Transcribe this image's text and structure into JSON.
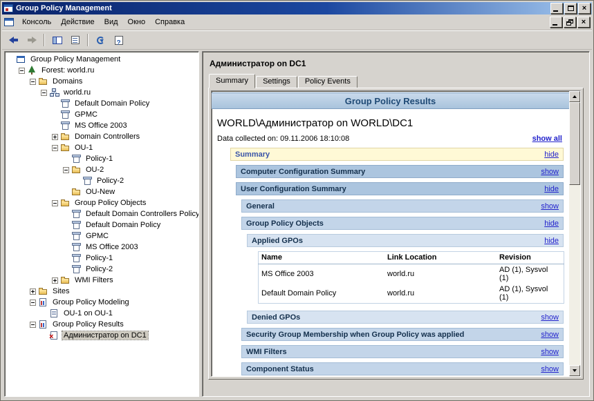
{
  "window": {
    "title": "Group Policy Management",
    "buttons": [
      "minimize",
      "maximize",
      "close"
    ]
  },
  "menubar": {
    "items": [
      "Консоль",
      "Действие",
      "Вид",
      "Окно",
      "Справка"
    ],
    "child_buttons": [
      "minimize",
      "restore",
      "close"
    ]
  },
  "toolbar": {
    "buttons": [
      "back",
      "forward",
      "separator",
      "show-console-tree",
      "export-list",
      "separator",
      "refresh",
      "help"
    ]
  },
  "tree": {
    "items": [
      {
        "depth": 0,
        "expander": null,
        "icon": "console-root",
        "label": "Group Policy Management"
      },
      {
        "depth": 1,
        "expander": "-",
        "icon": "forest",
        "label": "Forest: world.ru"
      },
      {
        "depth": 2,
        "expander": "-",
        "icon": "folder",
        "label": "Domains"
      },
      {
        "depth": 3,
        "expander": "-",
        "icon": "domain",
        "label": "world.ru"
      },
      {
        "depth": 4,
        "expander": null,
        "icon": "gpo-link",
        "label": "Default Domain Policy"
      },
      {
        "depth": 4,
        "expander": null,
        "icon": "gpo-link",
        "label": "GPMC"
      },
      {
        "depth": 4,
        "expander": null,
        "icon": "gpo-link",
        "label": "MS Office 2003"
      },
      {
        "depth": 4,
        "expander": "+",
        "icon": "ou",
        "label": "Domain Controllers"
      },
      {
        "depth": 4,
        "expander": "-",
        "icon": "ou",
        "label": "OU-1"
      },
      {
        "depth": 5,
        "expander": null,
        "icon": "gpo-link",
        "label": "Policy-1"
      },
      {
        "depth": 5,
        "expander": "-",
        "icon": "ou",
        "label": "OU-2"
      },
      {
        "depth": 6,
        "expander": null,
        "icon": "gpo-link",
        "label": "Policy-2"
      },
      {
        "depth": 5,
        "expander": null,
        "icon": "ou",
        "label": "OU-New"
      },
      {
        "depth": 4,
        "expander": "-",
        "icon": "folder",
        "label": "Group Policy Objects"
      },
      {
        "depth": 5,
        "expander": null,
        "icon": "gpo",
        "label": "Default Domain Controllers Policy"
      },
      {
        "depth": 5,
        "expander": null,
        "icon": "gpo",
        "label": "Default Domain Policy"
      },
      {
        "depth": 5,
        "expander": null,
        "icon": "gpo",
        "label": "GPMC"
      },
      {
        "depth": 5,
        "expander": null,
        "icon": "gpo",
        "label": "MS Office 2003"
      },
      {
        "depth": 5,
        "expander": null,
        "icon": "gpo",
        "label": "Policy-1"
      },
      {
        "depth": 5,
        "expander": null,
        "icon": "gpo",
        "label": "Policy-2"
      },
      {
        "depth": 4,
        "expander": "+",
        "icon": "folder",
        "label": "WMI Filters"
      },
      {
        "depth": 2,
        "expander": "+",
        "icon": "folder",
        "label": "Sites"
      },
      {
        "depth": 2,
        "expander": "-",
        "icon": "modeling",
        "label": "Group Policy Modeling"
      },
      {
        "depth": 3,
        "expander": null,
        "icon": "report",
        "label": "OU-1 on OU-1"
      },
      {
        "depth": 2,
        "expander": "-",
        "icon": "results",
        "label": "Group Policy Results"
      },
      {
        "depth": 3,
        "expander": null,
        "icon": "report-x",
        "label": "Администратор on DC1",
        "selected": true
      }
    ]
  },
  "content": {
    "page_title": "Администратор on DC1",
    "tabs": [
      {
        "label": "Summary",
        "active": true
      },
      {
        "label": "Settings",
        "active": false
      },
      {
        "label": "Policy Events",
        "active": false
      }
    ],
    "report": {
      "banner": "Group Policy Results",
      "subject": "WORLD\\Администратор on WORLD\\DC1",
      "collected": "Data collected on: 09.11.2006 18:10:08",
      "show_all": "show all",
      "sections": [
        {
          "label": "Summary",
          "link": "hide",
          "level": 0,
          "style": "summary"
        },
        {
          "label": "Computer Configuration Summary",
          "link": "show",
          "level": 1
        },
        {
          "label": "User Configuration Summary",
          "link": "hide",
          "level": 1
        },
        {
          "label": "General",
          "link": "show",
          "level": 2
        },
        {
          "label": "Group Policy Objects",
          "link": "hide",
          "level": 2
        },
        {
          "label": "Applied GPOs",
          "link": "hide",
          "level": 3,
          "table": {
            "headers": [
              "Name",
              "Link Location",
              "Revision"
            ],
            "rows": [
              [
                "MS Office 2003",
                "world.ru",
                "AD (1), Sysvol (1)"
              ],
              [
                "Default Domain Policy",
                "world.ru",
                "AD (1), Sysvol (1)"
              ]
            ]
          }
        },
        {
          "label": "Denied GPOs",
          "link": "show",
          "level": 3
        },
        {
          "label": "Security Group Membership when Group Policy was applied",
          "link": "show",
          "level": 2
        },
        {
          "label": "WMI Filters",
          "link": "show",
          "level": 2
        },
        {
          "label": "Component Status",
          "link": "show",
          "level": 2
        }
      ]
    },
    "colors": {
      "titlebar_start": "#0A246A",
      "titlebar_end": "#A6CAF0",
      "window_gray": "#D6D3CE",
      "band_level1": "#ACC5DF",
      "band_level2": "#C3D5E9",
      "band_level3": "#D7E3F1",
      "summary_band": "#FFF9D6",
      "link_blue": "#2222CC"
    }
  }
}
